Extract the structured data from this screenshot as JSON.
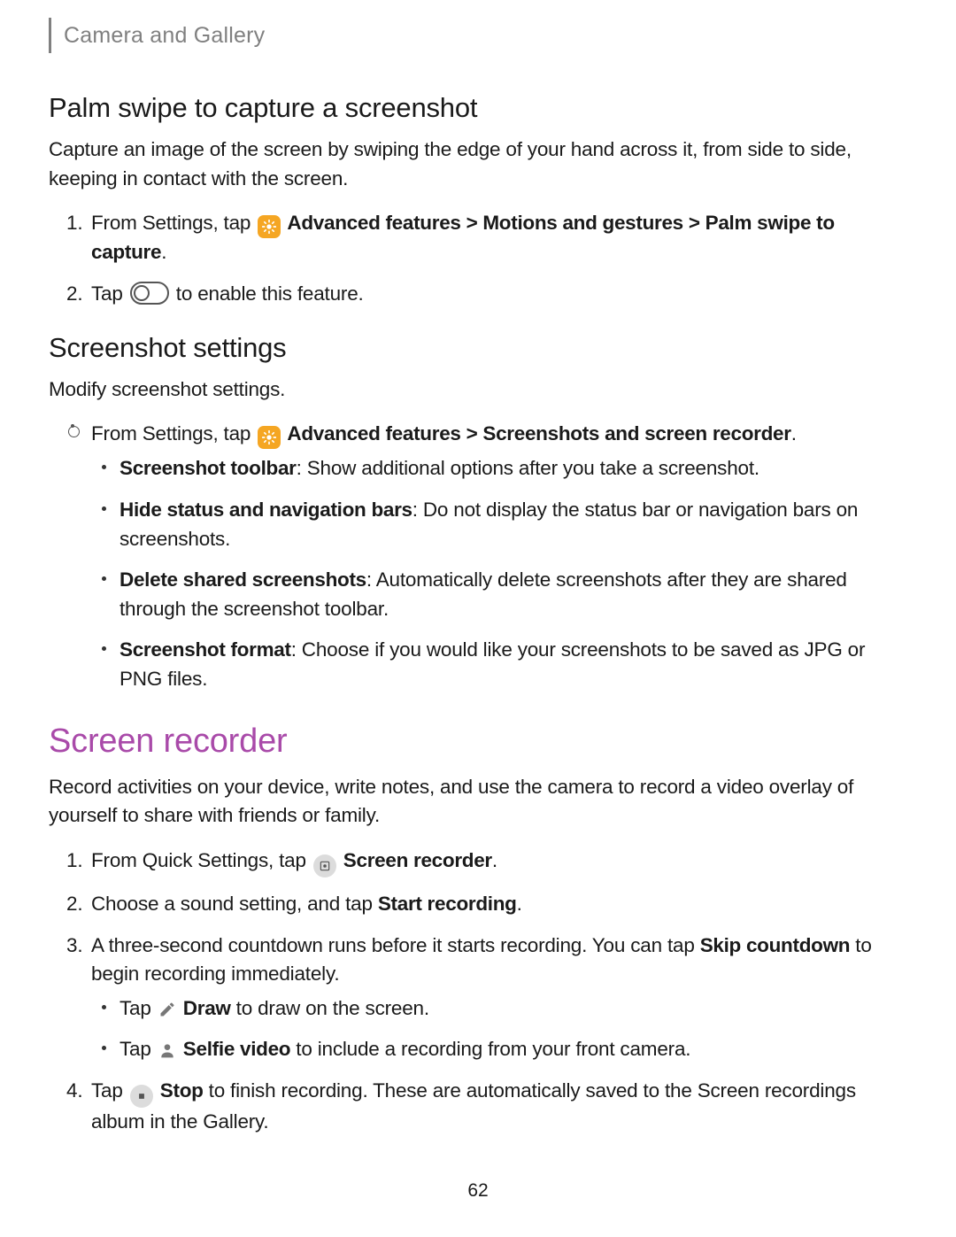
{
  "breadcrumb": "Camera and Gallery",
  "section1": {
    "heading": "Palm swipe to capture a screenshot",
    "intro": "Capture an image of the screen by swiping the edge of your hand across it, from side to side, keeping in contact with the screen.",
    "step1_pre": "From Settings, tap ",
    "step1_path": " Advanced features > Motions and gestures > Palm swipe to capture",
    "step2_pre": "Tap ",
    "step2_post": " to enable this feature."
  },
  "section2": {
    "heading": "Screenshot settings",
    "intro": "Modify screenshot settings.",
    "lead_pre": "From Settings, tap ",
    "lead_path": " Advanced features > Screenshots and screen recorder",
    "items": [
      {
        "term": "Screenshot toolbar",
        "desc": ": Show additional options after you take a screenshot."
      },
      {
        "term": "Hide status and navigation bars",
        "desc": ": Do not display the status bar or navigation bars on screenshots."
      },
      {
        "term": "Delete shared screenshots",
        "desc": ": Automatically delete screenshots after they are shared through the screenshot toolbar."
      },
      {
        "term": "Screenshot format",
        "desc": ": Choose if you would like your screenshots to be saved as JPG or PNG files."
      }
    ]
  },
  "section3": {
    "heading": "Screen recorder",
    "intro": "Record activities on your device, write notes, and use the camera to record a video overlay of yourself to share with friends or family.",
    "step1_pre": "From Quick Settings, tap ",
    "step1_label": " Screen recorder",
    "step2_pre": "Choose a sound setting, and tap ",
    "step2_strong": "Start recording",
    "step3_pre": "A three-second countdown runs before it starts recording. You can tap ",
    "step3_strong": "Skip countdown",
    "step3_post": " to begin recording immediately.",
    "sub_a_pre": "Tap ",
    "sub_a_strong": "Draw",
    "sub_a_post": " to draw on the screen.",
    "sub_b_pre": "Tap ",
    "sub_b_strong": "Selfie video",
    "sub_b_post": " to include a recording from your front camera.",
    "step4_pre": "Tap ",
    "step4_strong": "Stop",
    "step4_post": " to finish recording. These are automatically saved to the Screen recordings album in the Gallery."
  },
  "pagenum": "62"
}
